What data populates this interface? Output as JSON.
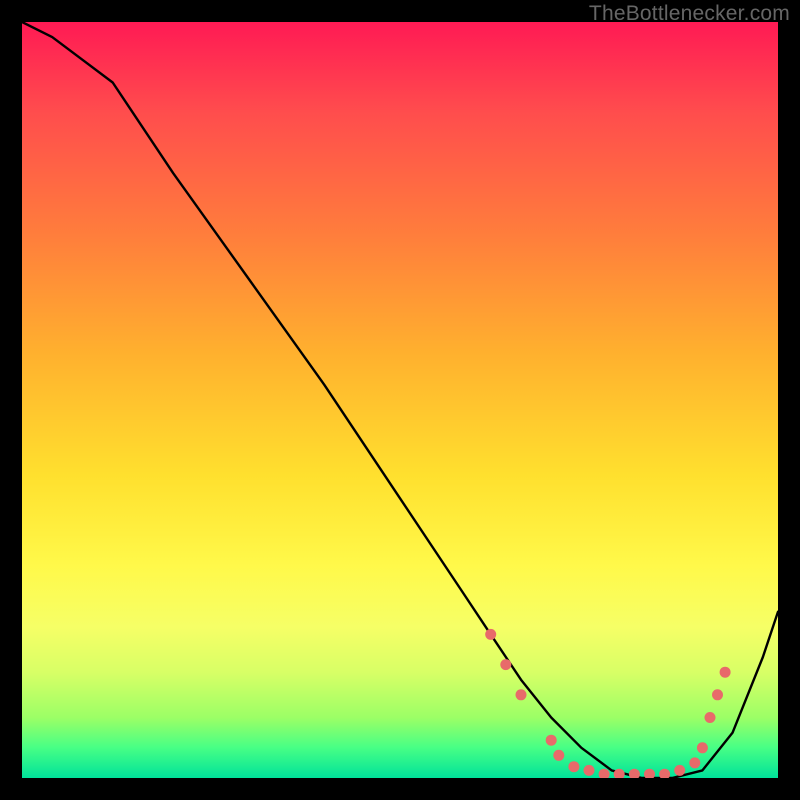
{
  "watermark": "TheBottlenecker.com",
  "chart_data": {
    "type": "line",
    "title": "",
    "xlabel": "",
    "ylabel": "",
    "xlim": [
      0,
      100
    ],
    "ylim": [
      0,
      100
    ],
    "gradient_stops": [
      {
        "pct": 0,
        "color": "#ff1a54"
      },
      {
        "pct": 12,
        "color": "#ff4d4d"
      },
      {
        "pct": 28,
        "color": "#ff7d3c"
      },
      {
        "pct": 44,
        "color": "#ffb12e"
      },
      {
        "pct": 60,
        "color": "#ffe02e"
      },
      {
        "pct": 72,
        "color": "#fff94a"
      },
      {
        "pct": 80,
        "color": "#f6ff66"
      },
      {
        "pct": 86,
        "color": "#d8ff66"
      },
      {
        "pct": 92,
        "color": "#9cff66"
      },
      {
        "pct": 96,
        "color": "#47ff85"
      },
      {
        "pct": 100,
        "color": "#00e29a"
      }
    ],
    "series": [
      {
        "name": "curve",
        "x": [
          0,
          4,
          8,
          12,
          20,
          30,
          40,
          50,
          58,
          62,
          66,
          70,
          74,
          78,
          82,
          86,
          90,
          94,
          98,
          100
        ],
        "y": [
          100,
          98,
          95,
          92,
          80,
          66,
          52,
          37,
          25,
          19,
          13,
          8,
          4,
          1,
          0,
          0,
          1,
          6,
          16,
          22
        ]
      }
    ],
    "markers": {
      "name": "highlight-dots",
      "color": "#e86a6a",
      "points": [
        {
          "x": 62,
          "y": 19
        },
        {
          "x": 64,
          "y": 15
        },
        {
          "x": 66,
          "y": 11
        },
        {
          "x": 70,
          "y": 5
        },
        {
          "x": 71,
          "y": 3
        },
        {
          "x": 73,
          "y": 1.5
        },
        {
          "x": 75,
          "y": 1
        },
        {
          "x": 77,
          "y": 0.5
        },
        {
          "x": 79,
          "y": 0.5
        },
        {
          "x": 81,
          "y": 0.5
        },
        {
          "x": 83,
          "y": 0.5
        },
        {
          "x": 85,
          "y": 0.5
        },
        {
          "x": 87,
          "y": 1
        },
        {
          "x": 89,
          "y": 2
        },
        {
          "x": 90,
          "y": 4
        },
        {
          "x": 91,
          "y": 8
        },
        {
          "x": 92,
          "y": 11
        },
        {
          "x": 93,
          "y": 14
        }
      ]
    }
  }
}
